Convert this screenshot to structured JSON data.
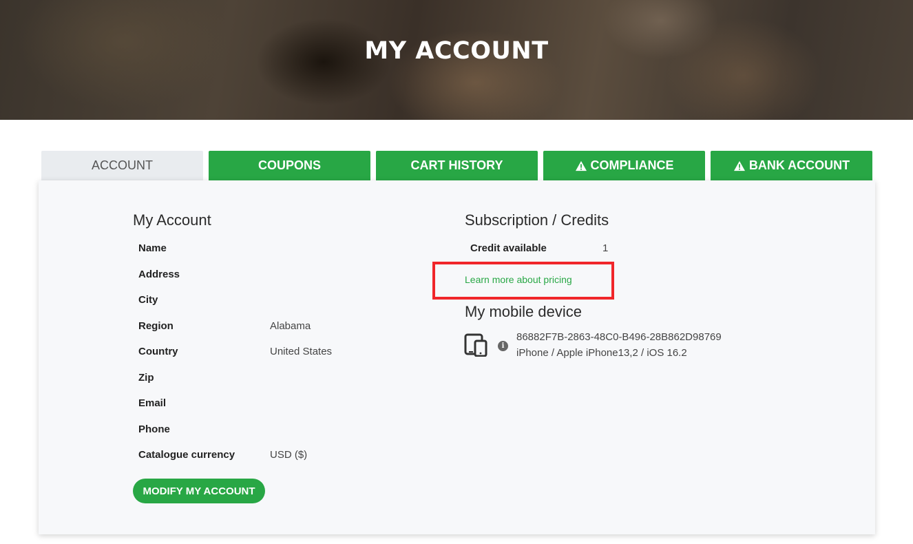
{
  "header": {
    "title": "MY ACCOUNT"
  },
  "tabs": [
    {
      "label": "ACCOUNT",
      "active": true,
      "warning": false
    },
    {
      "label": "COUPONS",
      "active": false,
      "warning": false
    },
    {
      "label": "CART HISTORY",
      "active": false,
      "warning": false
    },
    {
      "label": "COMPLIANCE",
      "active": false,
      "warning": true
    },
    {
      "label": "BANK ACCOUNT",
      "active": false,
      "warning": true
    }
  ],
  "account": {
    "title": "My Account",
    "fields": [
      {
        "label": "Name",
        "value": ""
      },
      {
        "label": "Address",
        "value": ""
      },
      {
        "label": "City",
        "value": ""
      },
      {
        "label": "Region",
        "value": "Alabama"
      },
      {
        "label": "Country",
        "value": "United States"
      },
      {
        "label": "Zip",
        "value": ""
      },
      {
        "label": "Email",
        "value": ""
      },
      {
        "label": "Phone",
        "value": ""
      },
      {
        "label": "Catalogue currency",
        "value": "USD ($)"
      }
    ],
    "modify_button": "MODIFY MY ACCOUNT"
  },
  "subscription": {
    "title": "Subscription / Credits",
    "credit_label": "Credit available",
    "credit_value": "1",
    "pricing_link": "Learn more about pricing"
  },
  "device": {
    "title": "My mobile device",
    "id": "86882F7B-2863-48C0-B496-28B862D98769",
    "description": "iPhone / Apple iPhone13,2 / iOS 16.2",
    "icon": "mobile-tablet-icon"
  },
  "colors": {
    "accent": "#28a745",
    "highlight": "#f0262a",
    "tab_inactive": "#e9ecef"
  }
}
